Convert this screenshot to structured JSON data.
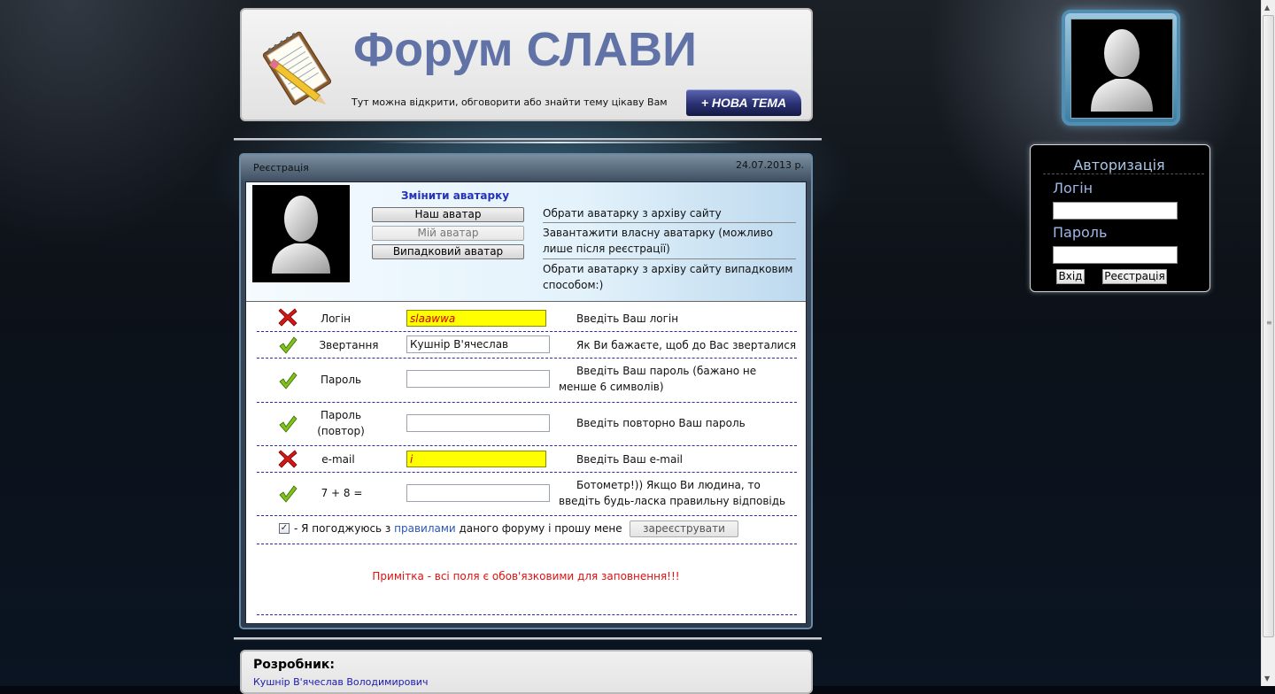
{
  "header": {
    "title": "Форум СЛАВИ",
    "subtitle": "Тут можна відкрити, обговорити або знайти тему цікаву Вам",
    "new_topic_label": "+ НОВА ТЕМА"
  },
  "panel": {
    "title": "Реєстрація",
    "date": "24.07.2013 р."
  },
  "avatar_section": {
    "change_label": "Змінити аватарку",
    "buttons": [
      {
        "label": "Наш аватар",
        "description": "Обрати аватарку з архіву сайту"
      },
      {
        "label": "Мій аватар",
        "description": "Завантажити власну аватарку (можливо лише після реєстрації)"
      },
      {
        "label": "Випадковий аватар",
        "description": "Обрати аватарку з архіву сайту випадковим способом:)"
      }
    ]
  },
  "form": {
    "rows": [
      {
        "status": "error",
        "label": "Логін",
        "value": "slaawwa",
        "hint": "Введіть Ваш логін"
      },
      {
        "status": "ok",
        "label": "Звертання",
        "value": "Кушнір В'ячеслав",
        "hint": "Як Ви бажаєте, щоб до Вас зверталися"
      },
      {
        "status": "ok",
        "label": "Пароль",
        "value": "",
        "hint": "Введіть Ваш пароль (бажано не менше 6 символів)"
      },
      {
        "status": "ok",
        "label": "Пароль (повтор)",
        "value": "",
        "hint": "Введіть повторно Ваш пароль"
      },
      {
        "status": "error",
        "label": "e-mail",
        "value": "i",
        "hint": "Введіть Ваш e-mail"
      },
      {
        "status": "ok",
        "label": "7 + 8 =",
        "value": "",
        "hint": "Ботометр!)) Якщо Ви людина, то введіть будь-ласка правильну відповідь"
      }
    ],
    "agree_prefix": "- Я погоджуюсь з ",
    "agree_link": "правилами",
    "agree_suffix": " даного форуму і прошу мене",
    "agree_checked": true,
    "register_button": "зареєструвати",
    "note": "Примітка - всі поля є обов'язковими для заповнення!!!"
  },
  "footer": {
    "title": "Розробник:",
    "developer": "Кушнір В'ячеслав Володимирович"
  },
  "auth": {
    "title": "Авторизація",
    "login_label": "Логін",
    "password_label": "Пароль",
    "login_button": "Вхід",
    "register_button": "Реєстрація"
  },
  "colors": {
    "title_blue": "#6173a6",
    "error_red": "#e01010",
    "input_error_bg": "#ffff00",
    "link_blue": "#2a56b8"
  },
  "icons": [
    "notepad-pencil-icon",
    "avatar-silhouette-icon",
    "error-cross-icon",
    "ok-check-icon",
    "checkbox-icon"
  ]
}
